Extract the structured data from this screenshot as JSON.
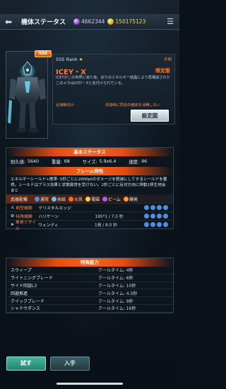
{
  "header": {
    "title": "機体ステータス",
    "gems": "4662344",
    "gold": "150175123"
  },
  "mech": {
    "rarity": "SSS",
    "rank": "SSS Rank",
    "unlimited_label": "不明",
    "name": "ICEY・X",
    "limited_label": "限定版",
    "description": "ICEYがこの世界に来た後、戻りのエネルギー結晶により再構成されたこのメカはICEY・Xと名付けられている。",
    "eta_label": "近接戦向け",
    "remodel_note": "改造時に同名の機体を消費しない",
    "setting_button": "設定図"
  },
  "status": {
    "header": "基本ステータス",
    "durability_label": "耐久値:",
    "durability": "5640",
    "weight_label": "重量:",
    "weight": "68",
    "size_label": "サイズ:",
    "size": "5.9x6.4",
    "speed_label": "速度:",
    "speed": "96",
    "frame_header": "フレーム特性",
    "frame_text": "エネルギーシールド+携帯: 5秒ごとに2000ptのダメージを軽減にしてするシールドを獲得。シールドはブラス効果と状態異常を受けない。2秒ごとに反対方向に移動1移生地会まと"
  },
  "weapons": {
    "header": "武器配備",
    "legend": [
      {
        "label": "通常",
        "color": "#4f8fe0"
      },
      {
        "label": "氷結",
        "color": "#5ec2ff"
      },
      {
        "label": "火炎",
        "color": "#ff6a2a"
      },
      {
        "label": "電磁",
        "color": "#ffd23a"
      },
      {
        "label": "ビーム",
        "color": "#b05aff"
      },
      {
        "label": "爆発",
        "color": "#ff9a2d"
      }
    ],
    "rows": [
      {
        "type": "剣型概鋼",
        "name": "クリスタルエッジ",
        "spec": ""
      },
      {
        "type": "特殊概鋼",
        "name": "ハリケーン",
        "spec": "195*1 / 7.0 秒"
      },
      {
        "type": "単発ミサイル",
        "name": "ウェンディ",
        "spec": "1発 / 8.0 秒"
      }
    ]
  },
  "abilities": {
    "header": "特殊能力",
    "rows": [
      {
        "name": "スウィープ",
        "cooldown": "クールタイム: 4秒"
      },
      {
        "name": "ライトニングブレード",
        "cooldown": "クールタイム: 6秒"
      },
      {
        "name": "サイド回旋L3",
        "cooldown": "クールタイム: 10秒"
      },
      {
        "name": "回避推進",
        "cooldown": "クールタイム: 4.5秒"
      },
      {
        "name": "クイックブレード",
        "cooldown": "クールタイム: 9秒"
      },
      {
        "name": "シャドウダンス",
        "cooldown": "クールタイム: 16秒"
      }
    ]
  },
  "footer": {
    "try_button": "試す",
    "get_button": "入手"
  }
}
